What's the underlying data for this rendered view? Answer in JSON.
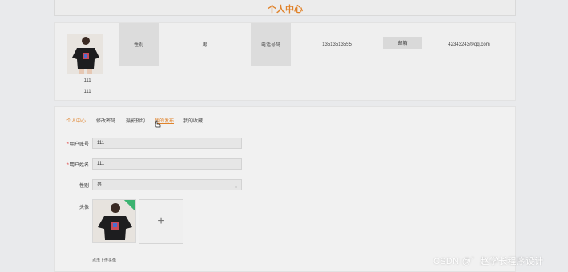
{
  "header": {
    "title": "个人中心"
  },
  "profile": {
    "nickname_line1": "111",
    "nickname_line2": "111",
    "gender_label": "性别",
    "gender_value": "男",
    "phone_label": "电话号码",
    "phone_value": "13513513555",
    "email_label": "邮箱",
    "email_value": "42343243@qq.com"
  },
  "tabs": [
    {
      "label": "个人中心",
      "state": "active"
    },
    {
      "label": "修改密码",
      "state": "normal"
    },
    {
      "label": "摄影预约",
      "state": "normal"
    },
    {
      "label": "我的发布",
      "state": "hover"
    },
    {
      "label": "我的收藏",
      "state": "normal"
    }
  ],
  "form": {
    "account_label": "用户账号",
    "account_value": "111",
    "name_label": "用户姓名",
    "name_value": "111",
    "gender_label": "性别",
    "gender_value": "男",
    "avatar_label": "头像",
    "upload_plus": "+",
    "upload_tip": "点击上传头像"
  },
  "watermark": "CSDN @゛赵学长程序设计",
  "colors": {
    "accent": "#e0822a",
    "required": "#e04040",
    "badge": "#3cb371"
  }
}
